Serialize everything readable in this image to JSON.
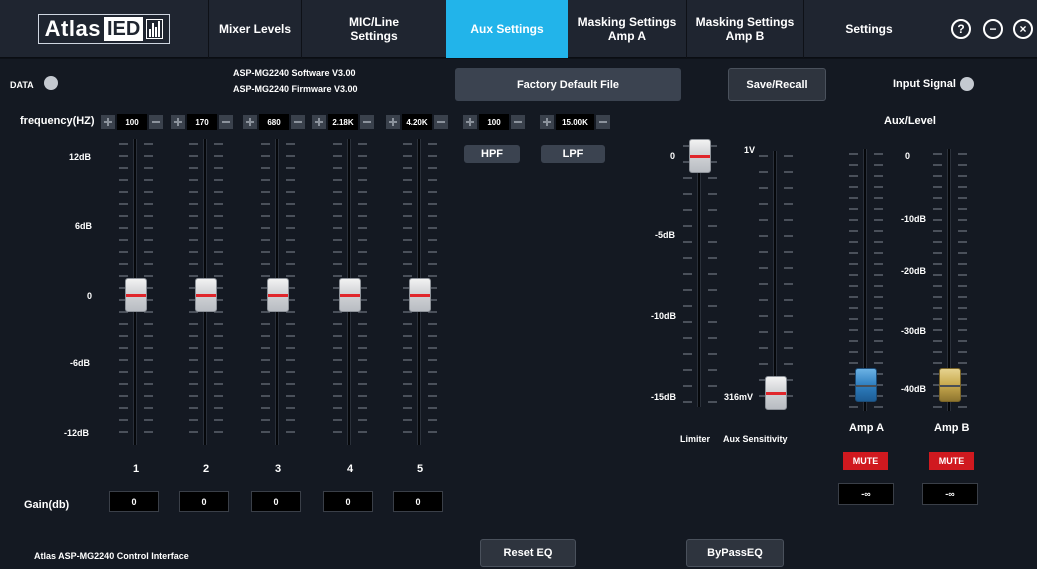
{
  "colors": {
    "accent": "#22b4ea",
    "mute": "#d0191f",
    "fader_mark": "#e0262b",
    "amp_a": "#2f7fc0",
    "amp_b": "#c8a94e"
  },
  "nav": {
    "logo": {
      "atlas": "Atlas",
      "ied": "IED"
    },
    "tabs": [
      {
        "label": "Mixer Levels",
        "active": false
      },
      {
        "label": "MIC/Line\nSettings",
        "active": false
      },
      {
        "label": "Aux Settings",
        "active": true
      },
      {
        "label": "Masking Settings\nAmp A",
        "active": false
      },
      {
        "label": "Masking Settings\nAmp B",
        "active": false
      },
      {
        "label": "Settings",
        "active": false
      }
    ],
    "icons": {
      "help": "?",
      "minimize": "−",
      "close": "×"
    }
  },
  "header": {
    "data_label": "DATA",
    "software": "ASP-MG2240 Software V3.00",
    "firmware": "ASP-MG2240 Firmware V3.00",
    "factory_button": "Factory Default File",
    "save_recall_button": "Save/Recall",
    "input_signal_label": "Input Signal"
  },
  "eq": {
    "frequency_label": "frequency(HZ)",
    "frequencies": [
      "100",
      "170",
      "680",
      "2.18K",
      "4.20K",
      "100",
      "15.00K"
    ],
    "db_labels": [
      "12dB",
      "6dB",
      "0",
      "-6dB",
      "-12dB"
    ],
    "band_numbers": [
      "1",
      "2",
      "3",
      "4",
      "5"
    ],
    "band_gain_db": [
      0,
      0,
      0,
      0,
      0
    ],
    "gain_label": "Gain(db)",
    "gain_values": [
      "0",
      "0",
      "0",
      "0",
      "0"
    ],
    "hpf_label": "HPF",
    "lpf_label": "LPF"
  },
  "limiter": {
    "scale": [
      "0",
      "-5dB",
      "-10dB",
      "-15dB"
    ],
    "level_db": 0,
    "label": "Limiter"
  },
  "aux_sensitivity": {
    "top_label": "1V",
    "current_value": "316mV",
    "label": "Aux Sensitivity"
  },
  "aux_level": {
    "title": "Aux/Level",
    "scale": [
      "0",
      "-10dB",
      "-20dB",
      "-30dB",
      "-40dB"
    ],
    "amp_a": {
      "label": "Amp A",
      "mute": "MUTE",
      "value": "-∞"
    },
    "amp_b": {
      "label": "Amp B",
      "mute": "MUTE",
      "value": "-∞"
    }
  },
  "footer": {
    "app_name": "Atlas ASP-MG2240 Control Interface",
    "reset_eq": "Reset EQ",
    "bypass_eq": "ByPassEQ"
  }
}
